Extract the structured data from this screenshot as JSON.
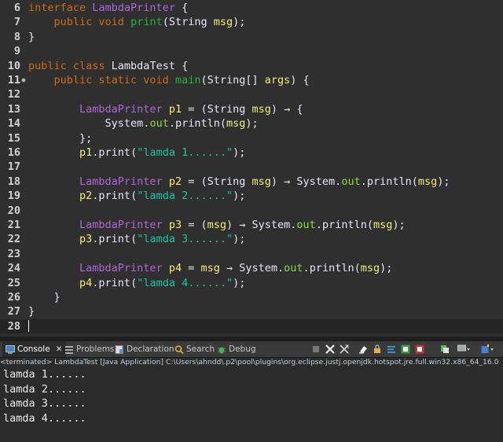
{
  "editor": {
    "lines": [
      {
        "n": "6",
        "segs": [
          [
            "kw",
            "interface "
          ],
          [
            "tp",
            "LambdaPrinter"
          ],
          [
            "pl",
            " {"
          ]
        ]
      },
      {
        "n": "7",
        "segs": [
          [
            "pl",
            "    "
          ],
          [
            "kw",
            "public void "
          ],
          [
            "fn",
            "print"
          ],
          [
            "pl",
            "(String "
          ],
          [
            "lv",
            "msg"
          ],
          [
            "pl",
            ");"
          ]
        ]
      },
      {
        "n": "8",
        "segs": [
          [
            "pl",
            "}"
          ]
        ]
      },
      {
        "n": "9",
        "segs": []
      },
      {
        "n": "10",
        "segs": [
          [
            "kw",
            "public class "
          ],
          [
            "pl",
            "LambdaTest {"
          ]
        ]
      },
      {
        "n": "11",
        "fold": true,
        "segs": [
          [
            "pl",
            "    "
          ],
          [
            "kw",
            "public static void "
          ],
          [
            "fn",
            "main"
          ],
          [
            "pl",
            "(String[] "
          ],
          [
            "lv",
            "args"
          ],
          [
            "pl",
            ") {"
          ]
        ]
      },
      {
        "n": "12",
        "segs": []
      },
      {
        "n": "13",
        "segs": [
          [
            "pl",
            "        "
          ],
          [
            "tp",
            "LambdaPrinter"
          ],
          [
            "pl",
            " "
          ],
          [
            "lv",
            "p1"
          ],
          [
            "pl",
            " = (String "
          ],
          [
            "lv",
            "msg"
          ],
          [
            "pl",
            ") → {"
          ]
        ]
      },
      {
        "n": "14",
        "segs": [
          [
            "pl",
            "            System."
          ],
          [
            "fld",
            "out"
          ],
          [
            "pl",
            ".println("
          ],
          [
            "lv",
            "msg"
          ],
          [
            "pl",
            ");"
          ]
        ]
      },
      {
        "n": "15",
        "segs": [
          [
            "pl",
            "        };"
          ]
        ]
      },
      {
        "n": "16",
        "segs": [
          [
            "pl",
            "        "
          ],
          [
            "lv",
            "p1"
          ],
          [
            "pl",
            ".print("
          ],
          [
            "str",
            "\"lamda 1......\""
          ],
          [
            "pl",
            ");"
          ]
        ]
      },
      {
        "n": "17",
        "segs": []
      },
      {
        "n": "18",
        "segs": [
          [
            "pl",
            "        "
          ],
          [
            "tp",
            "LambdaPrinter"
          ],
          [
            "pl",
            " "
          ],
          [
            "lv",
            "p2"
          ],
          [
            "pl",
            " = (String "
          ],
          [
            "lv",
            "msg"
          ],
          [
            "pl",
            ") → System."
          ],
          [
            "fld",
            "out"
          ],
          [
            "pl",
            ".println("
          ],
          [
            "lv",
            "msg"
          ],
          [
            "pl",
            ");"
          ]
        ]
      },
      {
        "n": "19",
        "segs": [
          [
            "pl",
            "        "
          ],
          [
            "lv",
            "p2"
          ],
          [
            "pl",
            ".print("
          ],
          [
            "str",
            "\"lamda 2......\""
          ],
          [
            "pl",
            ");"
          ]
        ]
      },
      {
        "n": "20",
        "segs": []
      },
      {
        "n": "21",
        "segs": [
          [
            "pl",
            "        "
          ],
          [
            "tp",
            "LambdaPrinter"
          ],
          [
            "pl",
            " "
          ],
          [
            "lv",
            "p3"
          ],
          [
            "pl",
            " = ("
          ],
          [
            "lv",
            "msg"
          ],
          [
            "pl",
            ") → System."
          ],
          [
            "fld",
            "out"
          ],
          [
            "pl",
            ".println("
          ],
          [
            "lv",
            "msg"
          ],
          [
            "pl",
            ");"
          ]
        ]
      },
      {
        "n": "22",
        "segs": [
          [
            "pl",
            "        "
          ],
          [
            "lv",
            "p3"
          ],
          [
            "pl",
            ".print("
          ],
          [
            "str",
            "\"lamda 3......\""
          ],
          [
            "pl",
            ");"
          ]
        ]
      },
      {
        "n": "23",
        "segs": []
      },
      {
        "n": "24",
        "segs": [
          [
            "pl",
            "        "
          ],
          [
            "tp",
            "LambdaPrinter"
          ],
          [
            "pl",
            " "
          ],
          [
            "lv",
            "p4"
          ],
          [
            "pl",
            " = "
          ],
          [
            "lv",
            "msg"
          ],
          [
            "pl",
            " → System."
          ],
          [
            "fld",
            "out"
          ],
          [
            "pl",
            ".println("
          ],
          [
            "lv",
            "msg"
          ],
          [
            "pl",
            ");"
          ]
        ]
      },
      {
        "n": "25",
        "segs": [
          [
            "pl",
            "        "
          ],
          [
            "lv",
            "p4"
          ],
          [
            "pl",
            ".print("
          ],
          [
            "str",
            "\"lamda 4......\""
          ],
          [
            "pl",
            ");"
          ]
        ]
      },
      {
        "n": "26",
        "segs": [
          [
            "pl",
            "    }"
          ]
        ]
      },
      {
        "n": "27",
        "segs": [
          [
            "pl",
            "}"
          ]
        ]
      },
      {
        "n": "28",
        "cursor": true,
        "segs": []
      }
    ]
  },
  "tabs": {
    "console": "Console",
    "problems": "Problems",
    "declaration": "Declaration",
    "search": "Search",
    "debug": "Debug"
  },
  "status_line": "<terminated> LambdaTest [Java Application] C:\\Users\\ahndd\\.p2\\pool\\plugins\\org.eclipse.justj.openjdk.hotspot.jre.full.win32.x86_64_16.0",
  "console_output": [
    "lamda 1......",
    "lamda 2......",
    "lamda 3......",
    "lamda 4......"
  ]
}
